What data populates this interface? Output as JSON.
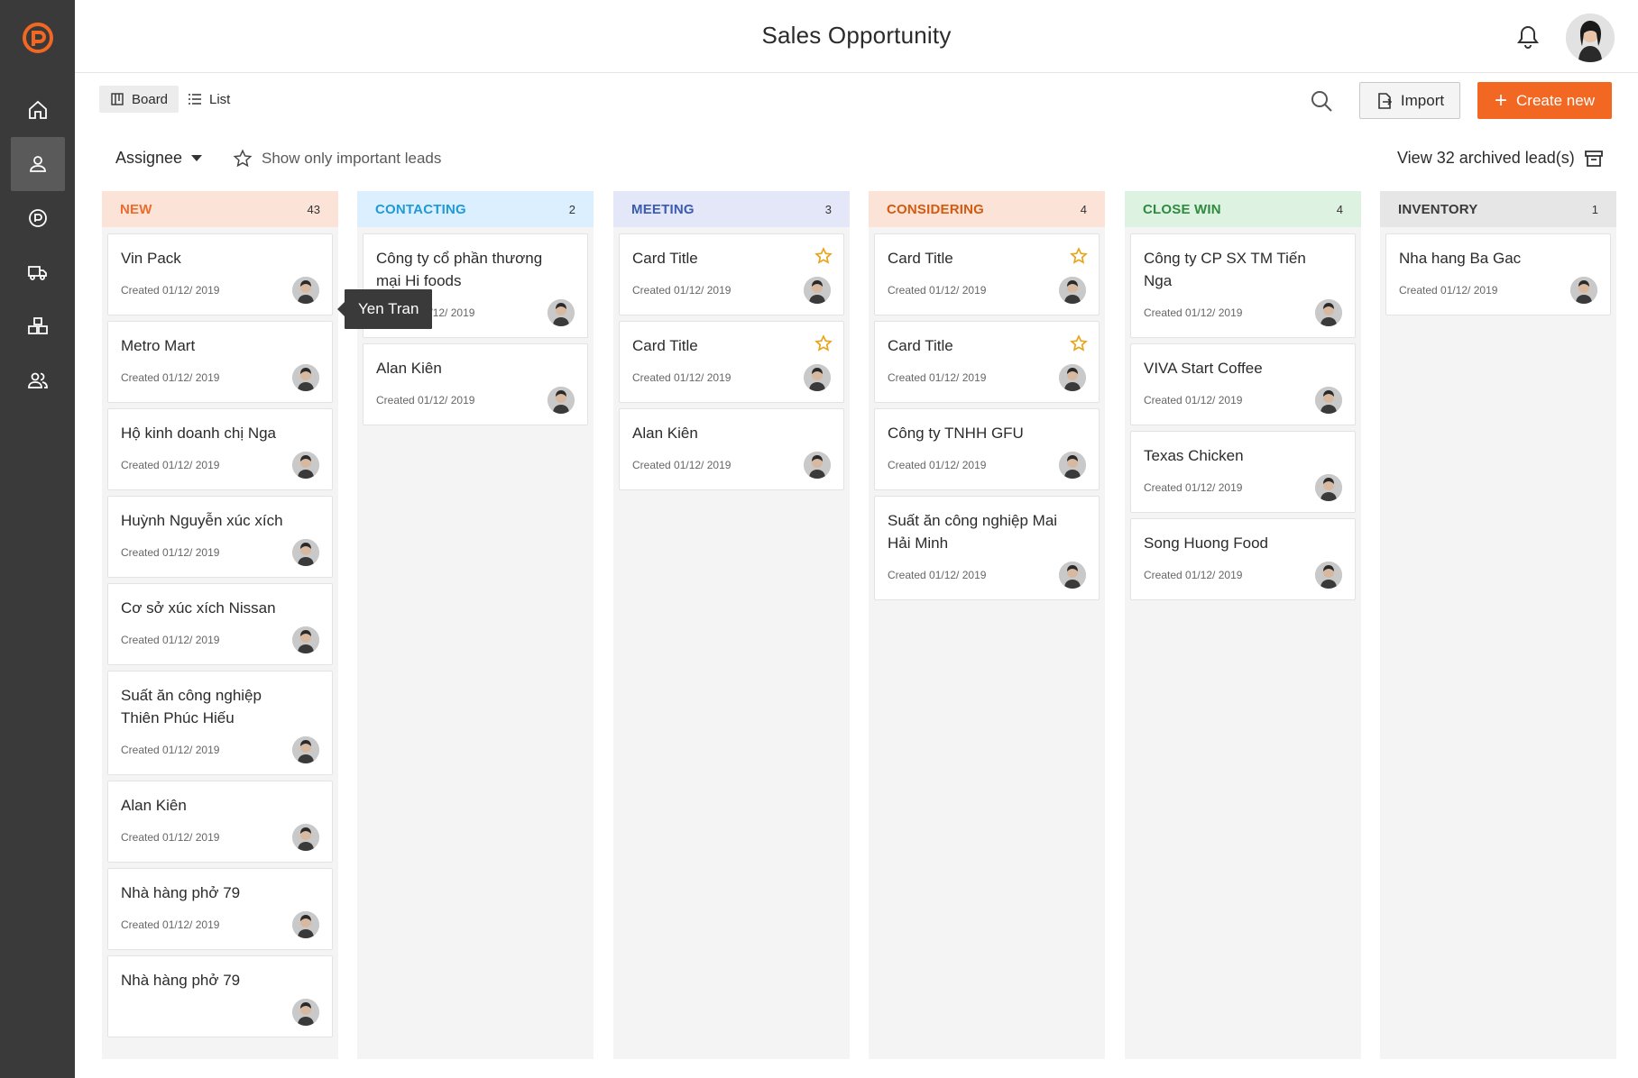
{
  "header": {
    "title": "Sales Opportunity"
  },
  "toolbar": {
    "board_label": "Board",
    "list_label": "List",
    "import_label": "Import",
    "create_label": "Create new",
    "assignee_label": "Assignee",
    "important_label": "Show only important leads",
    "archived_label": "View 32 archived lead(s)"
  },
  "colors": {
    "accent": "#f26722",
    "sidebar": "#3a3a3a"
  },
  "tooltip": {
    "text": "Yen Tran"
  },
  "columns": [
    {
      "title": "NEW",
      "count": "43",
      "header_bg": "#fbe3d8",
      "title_color": "#ef6b2c",
      "cards": [
        {
          "title": "Vin Pack",
          "created": "Created 01/12/ 2019",
          "starred": false
        },
        {
          "title": "Metro Mart",
          "created": "Created 01/12/ 2019",
          "starred": false
        },
        {
          "title": "Hộ kinh doanh chị Nga",
          "created": "Created 01/12/ 2019",
          "starred": false
        },
        {
          "title": "Huỳnh Nguyễn xúc xích",
          "created": "Created 01/12/ 2019",
          "starred": false
        },
        {
          "title": "Cơ sở xúc xích Nissan",
          "created": "Created 01/12/ 2019",
          "starred": false
        },
        {
          "title": "Suất ăn công nghiệp Thiên Phúc Hiếu",
          "created": "Created 01/12/ 2019",
          "starred": false
        },
        {
          "title": "Alan Kiên",
          "created": "Created 01/12/ 2019",
          "starred": false
        },
        {
          "title": "Nhà hàng phở 79",
          "created": "Created 01/12/ 2019",
          "starred": false
        },
        {
          "title": "Nhà hàng phở 79",
          "created": "",
          "starred": false
        }
      ]
    },
    {
      "title": "CONTACTING",
      "count": "2",
      "header_bg": "#dcefff",
      "title_color": "#1f9ad6",
      "cards": [
        {
          "title": "Công ty cổ phần thương mại Hi foods",
          "created": "Created 01/12/ 2019",
          "starred": false
        },
        {
          "title": "Alan Kiên",
          "created": "Created 01/12/ 2019",
          "starred": false
        }
      ]
    },
    {
      "title": "MEETING",
      "count": "3",
      "header_bg": "#e3e7f8",
      "title_color": "#3b5bb0",
      "cards": [
        {
          "title": "Card Title",
          "created": "Created 01/12/ 2019",
          "starred": true
        },
        {
          "title": "Card Title",
          "created": "Created 01/12/ 2019",
          "starred": true
        },
        {
          "title": "Alan Kiên",
          "created": "Created 01/12/ 2019",
          "starred": false
        }
      ]
    },
    {
      "title": "CONSIDERING",
      "count": "4",
      "header_bg": "#fbe3d8",
      "title_color": "#d45a0f",
      "cards": [
        {
          "title": "Card Title",
          "created": "Created 01/12/ 2019",
          "starred": true
        },
        {
          "title": "Card Title",
          "created": "Created 01/12/ 2019",
          "starred": true
        },
        {
          "title": "Công ty TNHH GFU",
          "created": "Created 01/12/ 2019",
          "starred": false
        },
        {
          "title": "Suất ăn công nghiệp Mai Hải Minh",
          "created": "Created 01/12/ 2019",
          "starred": false
        }
      ]
    },
    {
      "title": "CLOSE WIN",
      "count": "4",
      "header_bg": "#ddf2e1",
      "title_color": "#2e8b3e",
      "cards": [
        {
          "title": "Công ty CP SX TM Tiến Nga",
          "created": "Created 01/12/ 2019",
          "starred": false
        },
        {
          "title": "VIVA Start Coffee",
          "created": "Created 01/12/ 2019",
          "starred": false
        },
        {
          "title": "Texas Chicken",
          "created": "Created 01/12/ 2019",
          "starred": false
        },
        {
          "title": "Song Huong Food",
          "created": "Created 01/12/ 2019",
          "starred": false
        }
      ]
    },
    {
      "title": "INVENTORY",
      "count": "1",
      "header_bg": "#e6e6e6",
      "title_color": "#3a3a3a",
      "cards": [
        {
          "title": "Nha hang Ba Gac",
          "created": "Created 01/12/ 2019",
          "starred": false
        }
      ]
    }
  ]
}
